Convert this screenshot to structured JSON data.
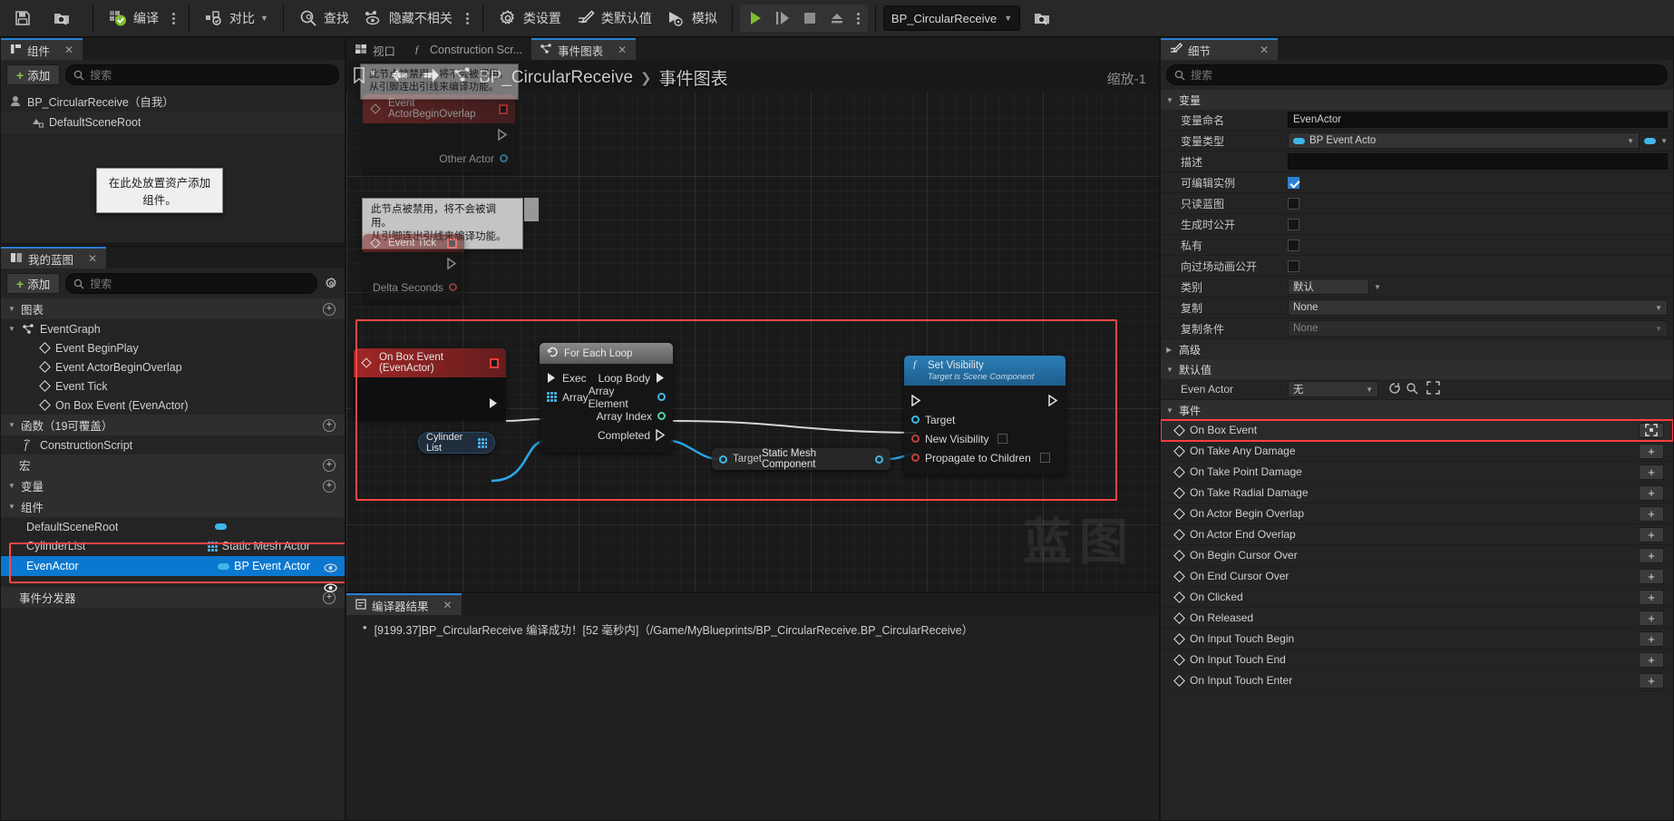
{
  "toolbar": {
    "save_label": "",
    "browse_label": "",
    "compile_label": "编译",
    "diff_label": "对比",
    "find_label": "查找",
    "hide_unrelated_label": "隐藏不相关",
    "class_settings_label": "类设置",
    "class_defaults_label": "类默认值",
    "simulate_label": "模拟",
    "blueprint_selector": "BP_CircularReceive"
  },
  "components_panel": {
    "tab_label": "组件",
    "add_label": "添加",
    "search_placeholder": "搜索",
    "root_item": "BP_CircularReceive（自我）",
    "child_item": "DefaultSceneRoot",
    "drop_hint": "在此处放置资产添加组件。"
  },
  "my_blueprint_panel": {
    "tab_label": "我的蓝图",
    "add_label": "添加",
    "search_placeholder": "搜索",
    "sections": {
      "graphs": "图表",
      "functions": "函数（19可覆盖）",
      "macros": "宏",
      "variables": "变量",
      "components": "组件",
      "event_dispatchers": "事件分发器"
    },
    "event_graph": "EventGraph",
    "graph_events": [
      "Event BeginPlay",
      "Event ActorBeginOverlap",
      "Event Tick",
      "On Box Event (EvenActor)"
    ],
    "functions": [
      "ConstructionScript"
    ],
    "components": [
      {
        "name": "DefaultSceneRoot",
        "type": "",
        "swatch": "#3fb6e8",
        "selected": false,
        "highlighted": false
      },
      {
        "name": "CylinderList",
        "type": "Static Mesh Actor",
        "swatch": "",
        "selected": false,
        "highlighted": true
      },
      {
        "name": "EvenActor",
        "type": "BP Event Actor",
        "swatch": "#3fb6e8",
        "selected": true,
        "highlighted": true
      }
    ]
  },
  "graph_area": {
    "tabs": [
      {
        "label": "视口",
        "active": false
      },
      {
        "label": "Construction Scr...",
        "active": false
      },
      {
        "label": "事件图表",
        "active": true
      }
    ],
    "breadcrumb": {
      "root": "BP_CircularReceive",
      "sep": "❯",
      "leaf": "事件图表"
    },
    "zoom_label": "缩放-1",
    "watermark": "蓝图",
    "comment_tooltip": "此节点被禁用，将不会被调用。\n从引脚连出引线来编译功能。",
    "nodes": [
      {
        "id": "event-actor-begin-overlap",
        "title": "Event ActorBeginOverlap",
        "kind": "event-disabled",
        "pins_out": [
          "",
          "Other Actor"
        ]
      },
      {
        "id": "event-tick",
        "title": "Event Tick",
        "kind": "event-disabled",
        "pins_out": [
          "",
          "Delta Seconds"
        ]
      },
      {
        "id": "on-box-event",
        "title": "On Box Event (EvenActor)",
        "kind": "event",
        "pins_out": [
          ""
        ]
      },
      {
        "id": "for-each-loop",
        "title": "For Each Loop",
        "kind": "macro",
        "pins_in": [
          "Exec",
          "Array"
        ],
        "pins_out": [
          "Loop Body",
          "Array Element",
          "Array Index",
          "Completed"
        ]
      },
      {
        "id": "cylinder-list",
        "title": "Cylinder List",
        "kind": "variable"
      },
      {
        "id": "static-mesh-component",
        "title": "Static Mesh Component",
        "kind": "cast",
        "pins_in": [
          "Target"
        ]
      },
      {
        "id": "set-visibility",
        "title": "Set Visibility",
        "subtitle": "Target is Scene Component",
        "kind": "function",
        "pins_in": [
          "Target",
          "New Visibility",
          "Propagate to Children"
        ]
      }
    ]
  },
  "compiler_results": {
    "tab_label": "编译器结果",
    "message": "[9199.37]BP_CircularReceive 编译成功！[52 毫秒内]（/Game/MyBlueprints/BP_CircularReceive.BP_CircularReceive）"
  },
  "details_panel": {
    "tab_label": "细节",
    "search_placeholder": "搜索",
    "sections": {
      "variable": "变量",
      "advanced": "高级",
      "defaults": "默认值",
      "events": "事件"
    },
    "variable_rows": [
      {
        "name": "变量命名",
        "type": "text",
        "value": "EvenActor"
      },
      {
        "name": "变量类型",
        "type": "vartype",
        "value": "BP Event Acto"
      },
      {
        "name": "描述",
        "type": "text",
        "value": ""
      },
      {
        "name": "可编辑实例",
        "type": "check",
        "checked": true
      },
      {
        "name": "只读蓝图",
        "type": "check",
        "checked": false
      },
      {
        "name": "生成时公开",
        "type": "check",
        "checked": false
      },
      {
        "name": "私有",
        "type": "check",
        "checked": false
      },
      {
        "name": "向过场动画公开",
        "type": "check",
        "checked": false
      },
      {
        "name": "类别",
        "type": "select",
        "value": "默认"
      },
      {
        "name": "复制",
        "type": "select",
        "value": "None"
      },
      {
        "name": "复制条件",
        "type": "select",
        "value": "None",
        "disabled": true
      }
    ],
    "defaults_rows": [
      {
        "name": "Even Actor",
        "type": "objselect",
        "value": "无"
      }
    ],
    "events": [
      {
        "label": "On Box Event",
        "highlighted": true,
        "btn": ""
      },
      {
        "label": "On Take Any Damage",
        "highlighted": false,
        "btn": "+"
      },
      {
        "label": "On Take Point Damage",
        "highlighted": false,
        "btn": "+"
      },
      {
        "label": "On Take Radial Damage",
        "highlighted": false,
        "btn": "+"
      },
      {
        "label": "On Actor Begin Overlap",
        "highlighted": false,
        "btn": "+"
      },
      {
        "label": "On Actor End Overlap",
        "highlighted": false,
        "btn": "+"
      },
      {
        "label": "On Begin Cursor Over",
        "highlighted": false,
        "btn": "+"
      },
      {
        "label": "On End Cursor Over",
        "highlighted": false,
        "btn": "+"
      },
      {
        "label": "On Clicked",
        "highlighted": false,
        "btn": "+"
      },
      {
        "label": "On Released",
        "highlighted": false,
        "btn": "+"
      },
      {
        "label": "On Input Touch Begin",
        "highlighted": false,
        "btn": "+"
      },
      {
        "label": "On Input Touch End",
        "highlighted": false,
        "btn": "+"
      },
      {
        "label": "On Input Touch Enter",
        "highlighted": false,
        "btn": "+"
      }
    ]
  },
  "colors": {
    "accent_blue": "#0b78d0",
    "highlight_red": "#ff3d3d",
    "green": "#89c341",
    "pin_blue": "#3fb6e8"
  }
}
